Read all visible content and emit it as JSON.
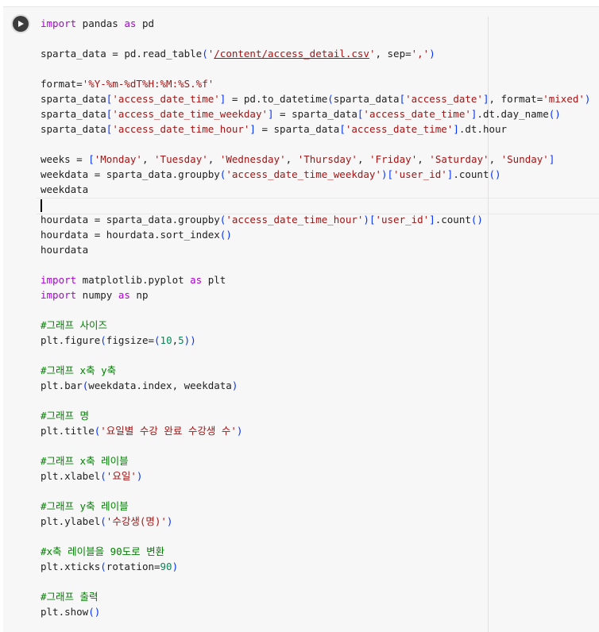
{
  "cell": {
    "run_icon": "play-icon",
    "lines": [
      "import pandas as pd",
      "",
      "sparta_data = pd.read_table('/content/access_detail.csv', sep=',')",
      "",
      "format='%Y-%m-%dT%H:%M:%S.%f'",
      "sparta_data['access_date_time'] = pd.to_datetime(sparta_data['access_date'], format='mixed')",
      "sparta_data['access_date_time_weekday'] = sparta_data['access_date_time'].dt.day_name()",
      "sparta_data['access_date_time_hour'] = sparta_data['access_date_time'].dt.hour",
      "",
      "weeks = ['Monday', 'Tuesday', 'Wednesday', 'Thursday', 'Friday', 'Saturday', 'Sunday']",
      "weekdata = sparta_data.groupby('access_date_time_weekday')['user_id'].count()",
      "weekdata",
      "",
      "hourdata = sparta_data.groupby('access_date_time_hour')['user_id'].count()",
      "hourdata = hourdata.sort_index()",
      "hourdata",
      "",
      "import matplotlib.pyplot as plt",
      "import numpy as np",
      "",
      "#그래프 사이즈",
      "plt.figure(figsize=(10,5))",
      "",
      "#그래프 x축 y축",
      "plt.bar(weekdata.index, weekdata)",
      "",
      "#그래프 명",
      "plt.title('요일별 수강 완료 수강생 수')",
      "",
      "#그래프 x축 레이블",
      "plt.xlabel('요일')",
      "",
      "#그래프 y축 레이블",
      "plt.ylabel('수강생(명)')",
      "",
      "#x축 레이블을 90도로 변환",
      "plt.xticks(rotation=90)",
      "",
      "#그래프 출력",
      "plt.show()"
    ]
  }
}
